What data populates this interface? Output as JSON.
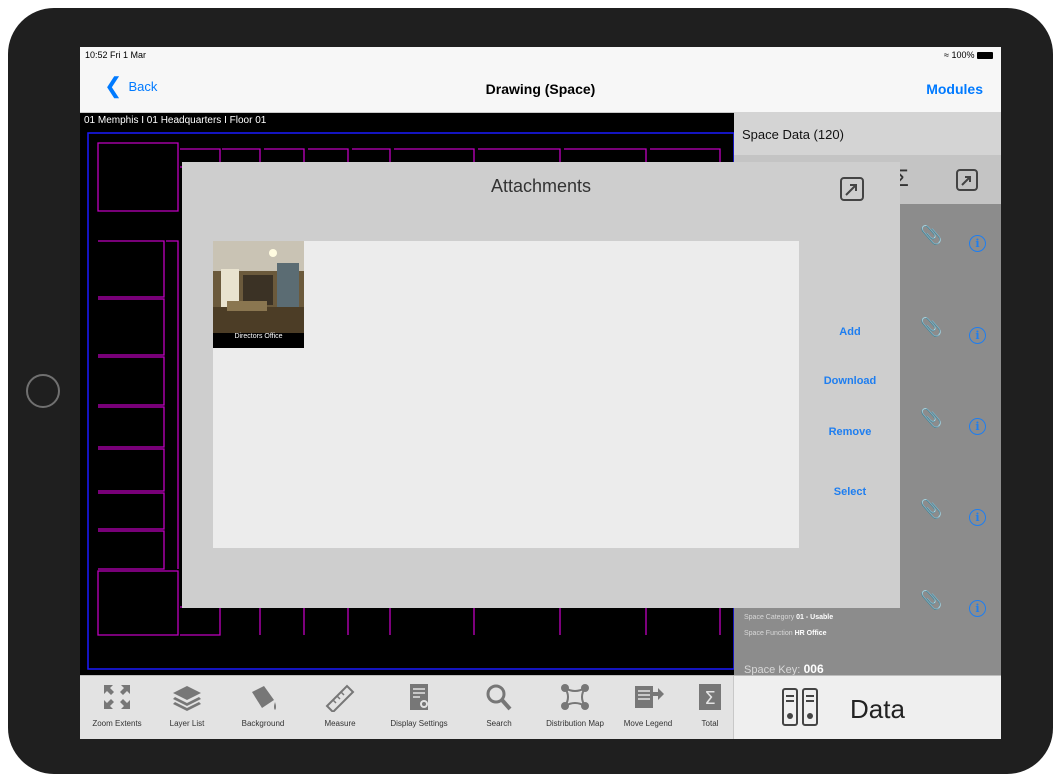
{
  "status_bar": {
    "time": "10:52  Fri 1 Mar",
    "battery": "100%"
  },
  "nav": {
    "back_label": "Back",
    "title": "Drawing (Space)",
    "modules_label": "Modules"
  },
  "drawing": {
    "breadcrumb": "01 Memphis I 01 Headquarters I Floor 01"
  },
  "right_panel": {
    "title": "Space Data (120)",
    "rows": [
      {
        "space_category_label": "Space Category",
        "space_category_value": "01 - Usable",
        "space_function_label": "Space Function",
        "space_function_value": "HR Office"
      }
    ],
    "space_key_label": "Space Key:",
    "space_key_value": "006"
  },
  "modal": {
    "title": "Attachments",
    "attachments": [
      {
        "caption": "Directors Office"
      }
    ],
    "actions": {
      "add": "Add",
      "download": "Download",
      "remove": "Remove",
      "select": "Select"
    }
  },
  "toolbar": {
    "items": [
      {
        "label": "Zoom Extents"
      },
      {
        "label": "Layer List"
      },
      {
        "label": "Background"
      },
      {
        "label": "Measure"
      },
      {
        "label": "Display Settings"
      },
      {
        "label": "Search"
      },
      {
        "label": "Distribution Map"
      },
      {
        "label": "Move Legend"
      },
      {
        "label": "Total"
      }
    ],
    "data_tab": "Data"
  },
  "colors": {
    "accent": "#1e7ef0",
    "floorplan_line": "#c000c0",
    "floorplan_border": "#1a1aff"
  }
}
